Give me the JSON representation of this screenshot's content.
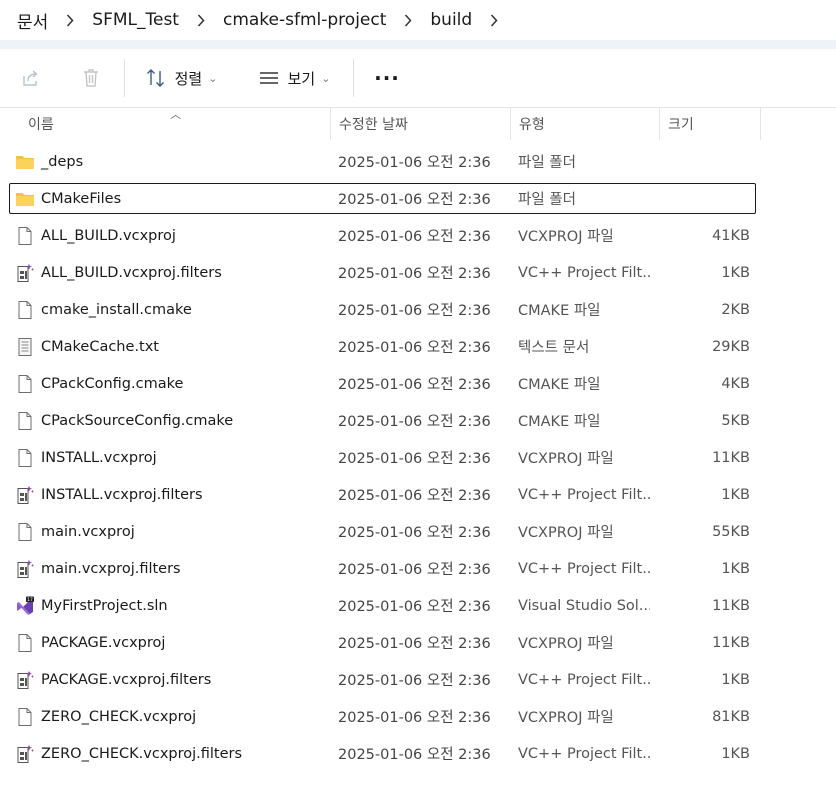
{
  "breadcrumb": {
    "items": [
      "문서",
      "SFML_Test",
      "cmake-sfml-project",
      "build"
    ]
  },
  "toolbar": {
    "share_icon": "share-icon",
    "delete_icon": "trash-icon",
    "sort_label": "정렬",
    "view_label": "보기",
    "more_label": "···"
  },
  "columns": {
    "name": "이름",
    "date": "수정한 날짜",
    "type": "유형",
    "size": "크기"
  },
  "files": [
    {
      "name": "_deps",
      "date": "2025-01-06 오전 2:36",
      "type": "파일 폴더",
      "size": "",
      "icon": "folder-icon"
    },
    {
      "name": "CMakeFiles",
      "date": "2025-01-06 오전 2:36",
      "type": "파일 폴더",
      "size": "",
      "icon": "folder-icon"
    },
    {
      "name": "ALL_BUILD.vcxproj",
      "date": "2025-01-06 오전 2:36",
      "type": "VCXPROJ 파일",
      "size": "41KB",
      "icon": "file-icon"
    },
    {
      "name": "ALL_BUILD.vcxproj.filters",
      "date": "2025-01-06 오전 2:36",
      "type": "VC++ Project Filt...",
      "size": "1KB",
      "icon": "vc-filters-icon"
    },
    {
      "name": "cmake_install.cmake",
      "date": "2025-01-06 오전 2:36",
      "type": "CMAKE 파일",
      "size": "2KB",
      "icon": "file-icon"
    },
    {
      "name": "CMakeCache.txt",
      "date": "2025-01-06 오전 2:36",
      "type": "텍스트 문서",
      "size": "29KB",
      "icon": "text-file-icon"
    },
    {
      "name": "CPackConfig.cmake",
      "date": "2025-01-06 오전 2:36",
      "type": "CMAKE 파일",
      "size": "4KB",
      "icon": "file-icon"
    },
    {
      "name": "CPackSourceConfig.cmake",
      "date": "2025-01-06 오전 2:36",
      "type": "CMAKE 파일",
      "size": "5KB",
      "icon": "file-icon"
    },
    {
      "name": "INSTALL.vcxproj",
      "date": "2025-01-06 오전 2:36",
      "type": "VCXPROJ 파일",
      "size": "11KB",
      "icon": "file-icon"
    },
    {
      "name": "INSTALL.vcxproj.filters",
      "date": "2025-01-06 오전 2:36",
      "type": "VC++ Project Filt...",
      "size": "1KB",
      "icon": "vc-filters-icon"
    },
    {
      "name": "main.vcxproj",
      "date": "2025-01-06 오전 2:36",
      "type": "VCXPROJ 파일",
      "size": "55KB",
      "icon": "file-icon"
    },
    {
      "name": "main.vcxproj.filters",
      "date": "2025-01-06 오전 2:36",
      "type": "VC++ Project Filt...",
      "size": "1KB",
      "icon": "vc-filters-icon"
    },
    {
      "name": "MyFirstProject.sln",
      "date": "2025-01-06 오전 2:36",
      "type": "Visual Studio Sol...",
      "size": "11KB",
      "icon": "visual-studio-solution-icon"
    },
    {
      "name": "PACKAGE.vcxproj",
      "date": "2025-01-06 오전 2:36",
      "type": "VCXPROJ 파일",
      "size": "11KB",
      "icon": "file-icon"
    },
    {
      "name": "PACKAGE.vcxproj.filters",
      "date": "2025-01-06 오전 2:36",
      "type": "VC++ Project Filt...",
      "size": "1KB",
      "icon": "vc-filters-icon"
    },
    {
      "name": "ZERO_CHECK.vcxproj",
      "date": "2025-01-06 오전 2:36",
      "type": "VCXPROJ 파일",
      "size": "81KB",
      "icon": "file-icon"
    },
    {
      "name": "ZERO_CHECK.vcxproj.filters",
      "date": "2025-01-06 오전 2:36",
      "type": "VC++ Project Filt...",
      "size": "1KB",
      "icon": "vc-filters-icon"
    }
  ],
  "focused_index": 1,
  "colors": {
    "folder": "#f4c243",
    "focus_border": "#1a1a1a",
    "vs_purple": "#6a3fb5"
  }
}
